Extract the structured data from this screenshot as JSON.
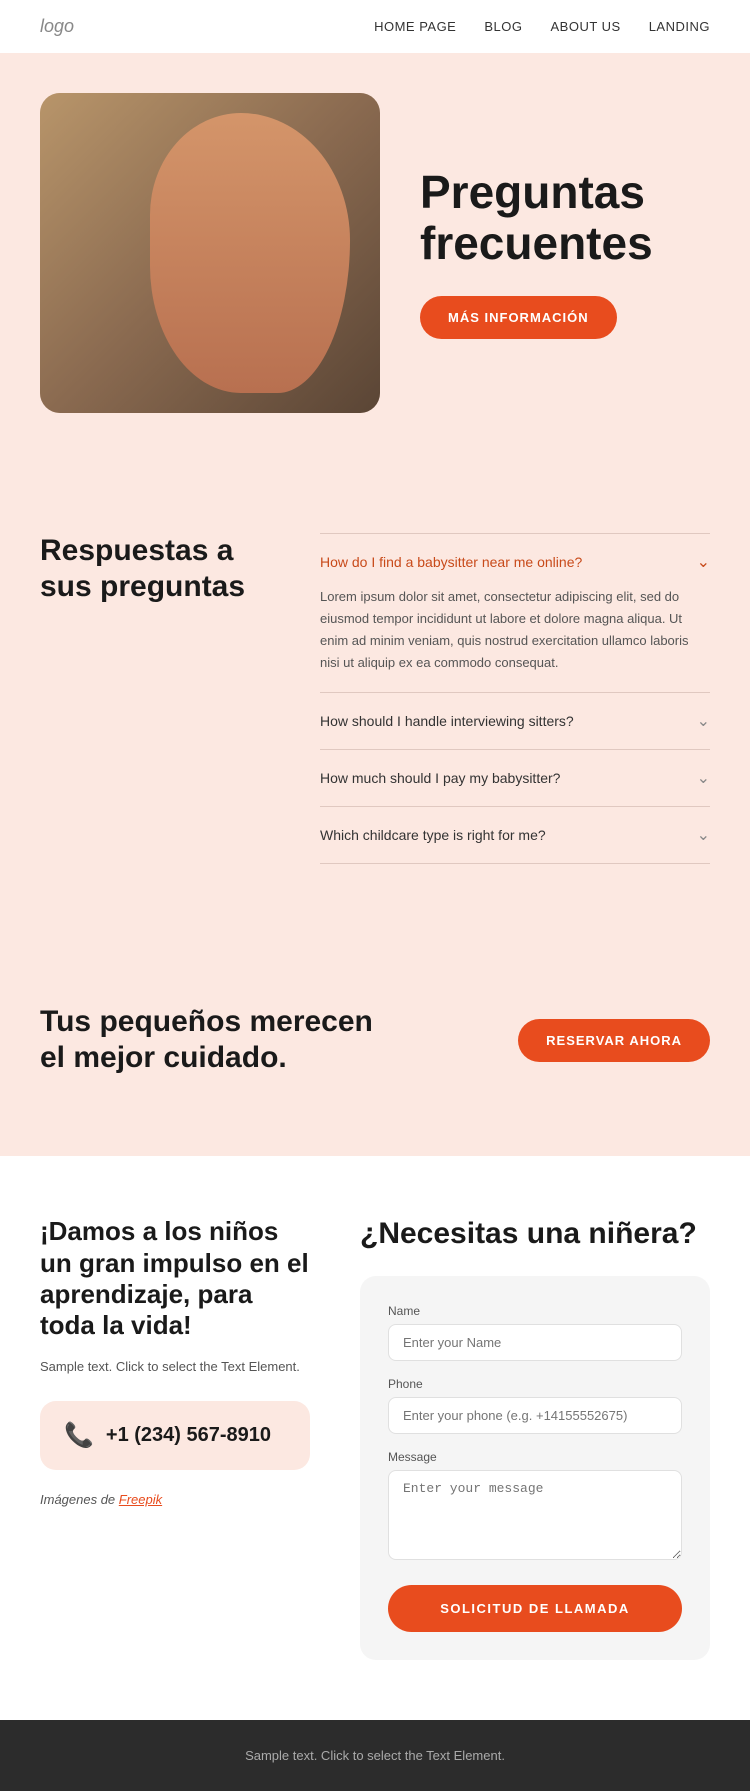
{
  "nav": {
    "logo": "logo",
    "links": [
      {
        "label": "HOME PAGE",
        "id": "home"
      },
      {
        "label": "BLOG",
        "id": "blog"
      },
      {
        "label": "ABOUT US",
        "id": "about"
      },
      {
        "label": "LANDING",
        "id": "landing"
      }
    ]
  },
  "hero": {
    "title": "Preguntas frecuentes",
    "cta_label": "MÁS INFORMACIÓN"
  },
  "faq": {
    "section_title": "Respuestas a sus preguntas",
    "items": [
      {
        "question": "How do I find a babysitter near me online?",
        "open": true,
        "answer": "Lorem ipsum dolor sit amet, consectetur adipiscing elit, sed do eiusmod tempor incididunt ut labore et dolore magna aliqua. Ut enim ad minim veniam, quis nostrud exercitation ullamco laboris nisi ut aliquip ex ea commodo consequat."
      },
      {
        "question": "How should I handle interviewing sitters?",
        "open": false,
        "answer": ""
      },
      {
        "question": "How much should I pay my babysitter?",
        "open": false,
        "answer": ""
      },
      {
        "question": "Which childcare type is right for me?",
        "open": false,
        "answer": ""
      }
    ]
  },
  "cta": {
    "text": "Tus pequeños merecen el mejor cuidado.",
    "button_label": "RESERVAR AHORA"
  },
  "contact": {
    "left_title": "¡Damos a los niños un gran impulso en el aprendizaje, para toda la vida!",
    "left_text": "Sample text. Click to select the Text Element.",
    "phone": "+1 (234) 567-8910",
    "credit_text": "Imágenes de ",
    "credit_link": "Freepik",
    "right_title": "¿Necesitas una niñera?",
    "form": {
      "name_label": "Name",
      "name_placeholder": "Enter your Name",
      "phone_label": "Phone",
      "phone_placeholder": "Enter your phone (e.g. +14155552675)",
      "message_label": "Message",
      "message_placeholder": "Enter your message",
      "submit_label": "SOLICITUD DE LLAMADA"
    }
  },
  "footer": {
    "text": "Sample text. Click to select the Text Element."
  }
}
